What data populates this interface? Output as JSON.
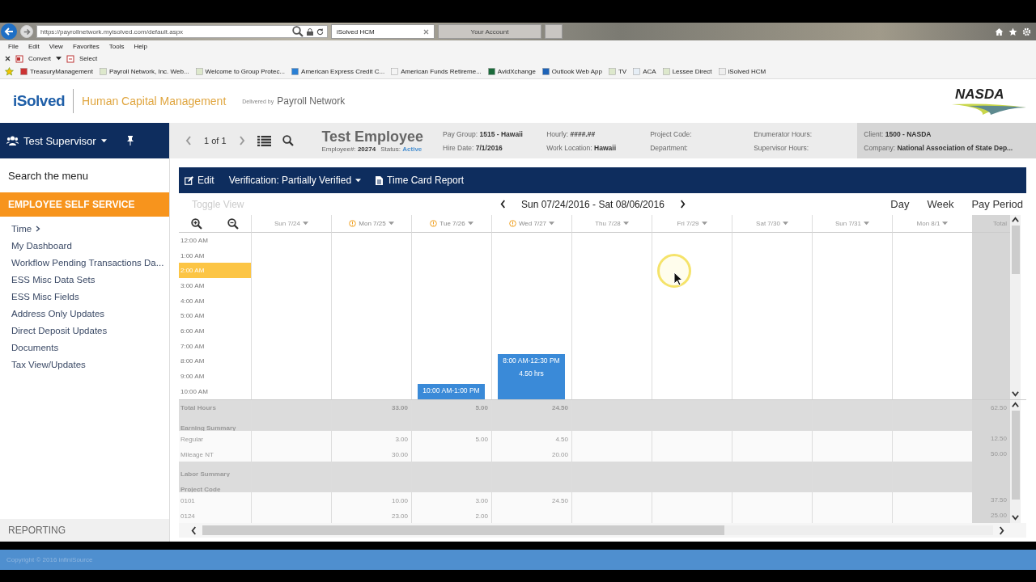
{
  "browser": {
    "address": "https://payrollnetwork.myisolved.com/default.aspx",
    "tabs": [
      {
        "title": "iSolved HCM",
        "selected": true
      },
      {
        "title": "Your Account",
        "selected": false
      }
    ],
    "menu": [
      "File",
      "Edit",
      "View",
      "Favorites",
      "Tools",
      "Help"
    ],
    "commands": [
      "Convert",
      "Select"
    ],
    "favorites": [
      "TreasuryManagement",
      "Payroll Network, Inc. Web...",
      "Welcome to Group Protec...",
      "American Express Credit C...",
      "American Funds Retireme...",
      "AvidXchange",
      "Outlook Web App",
      "TV",
      "ACA",
      "Lessee Direct",
      "iSolved HCM"
    ]
  },
  "header": {
    "logo": "iSolved",
    "product": "Human Capital Management",
    "delivered_by": "Delivered by",
    "partner": "Payroll Network",
    "client_logo": "NASDA"
  },
  "user": {
    "name": "Test Supervisor"
  },
  "pager": "1 of 1",
  "employee": {
    "name": "Test Employee",
    "number_label": "Employee#:",
    "number": "20274",
    "status_label": "Status:",
    "status": "Active",
    "fields": [
      [
        {
          "label": "Pay Group:",
          "value": "1515 - Hawaii"
        },
        {
          "label": "Hire Date:",
          "value": "7/1/2016"
        }
      ],
      [
        {
          "label": "Hourly:",
          "value": "####.##"
        },
        {
          "label": "Work Location:",
          "value": "Hawaii"
        }
      ],
      [
        {
          "label": "Project Code:"
        },
        {
          "label": "Department:"
        }
      ],
      [
        {
          "label": "Enumerator Hours:"
        },
        {
          "label": "Supervisor Hours:"
        }
      ]
    ],
    "client": [
      {
        "label": "Client:",
        "value": "1500 - NASDA"
      },
      {
        "label": "Company:",
        "value": "National Association of State Dep..."
      }
    ]
  },
  "sidebar": {
    "search": {
      "placeholder": "Search the menu"
    },
    "section": "EMPLOYEE SELF SERVICE",
    "items": [
      {
        "label": "Time",
        "submenu": true
      },
      {
        "label": "My Dashboard",
        "submenu": false
      },
      {
        "label": "Workflow Pending Transactions Da...",
        "submenu": false
      },
      {
        "label": "ESS Misc Data Sets",
        "submenu": false
      },
      {
        "label": "ESS Misc Fields",
        "submenu": false
      },
      {
        "label": "Address Only Updates",
        "submenu": false
      },
      {
        "label": "Direct Deposit Updates",
        "submenu": false
      },
      {
        "label": "Documents",
        "submenu": false
      },
      {
        "label": "Tax View/Updates",
        "submenu": false
      }
    ],
    "footer": "REPORTING"
  },
  "toolbar": {
    "edit": "Edit",
    "verification": "Verification: Partially Verified",
    "report": "Time Card Report"
  },
  "calendar": {
    "toggle": {
      "label": "Toggle View",
      "disabled": true
    },
    "range": "Sun 07/24/2016 - Sat 08/06/2016",
    "views": [
      "Day",
      "Week",
      "Pay Period"
    ],
    "total_label": "Total",
    "days": [
      {
        "label": "Sun 7/24",
        "flagged": false
      },
      {
        "label": "Mon 7/25",
        "flagged": true
      },
      {
        "label": "Tue 7/26",
        "flagged": true
      },
      {
        "label": "Wed 7/27",
        "flagged": true
      },
      {
        "label": "Thu 7/28",
        "flagged": false
      },
      {
        "label": "Fri 7/29",
        "flagged": false
      },
      {
        "label": "Sat 7/30",
        "flagged": false
      },
      {
        "label": "Sun 7/31",
        "flagged": false
      },
      {
        "label": "Mon 8/1",
        "flagged": false
      }
    ],
    "hours": [
      {
        "label": "12:00 AM",
        "selected": false
      },
      {
        "label": "1:00 AM",
        "selected": false
      },
      {
        "label": "2:00 AM",
        "selected": true
      },
      {
        "label": "3:00 AM",
        "selected": false
      },
      {
        "label": "4:00 AM",
        "selected": false
      },
      {
        "label": "5:00 AM",
        "selected": false
      },
      {
        "label": "6:00 AM",
        "selected": false
      },
      {
        "label": "7:00 AM",
        "selected": false
      },
      {
        "label": "8:00 AM",
        "selected": false,
        "cells": [
          {
            "kind": "blank"
          },
          {
            "kind": "blank"
          },
          {
            "kind": "blank"
          },
          {
            "kind": "event",
            "time": "8:00 AM-12:30 PM",
            "duration": "4.50 hrs"
          },
          {
            "kind": "blank"
          },
          {
            "kind": "blank"
          },
          {
            "kind": "blank"
          },
          {
            "kind": "blank"
          },
          {
            "kind": "blank"
          }
        ]
      },
      {
        "label": "9:00 AM",
        "selected": false
      },
      {
        "label": "10:00 AM",
        "selected": false,
        "cells": [
          {
            "kind": "blank"
          },
          {
            "kind": "blank"
          },
          {
            "kind": "event",
            "time": "10:00 AM-1:00 PM"
          },
          {
            "kind": "blank"
          },
          {
            "kind": "blank"
          },
          {
            "kind": "blank"
          },
          {
            "kind": "blank"
          },
          {
            "kind": "blank"
          },
          {
            "kind": "blank"
          }
        ]
      }
    ],
    "summary": [
      {
        "kind": "total",
        "label": "Total Hours",
        "cells": [
          {
            "kind": "blank"
          },
          {
            "kind": "value",
            "text": "33.00"
          },
          {
            "kind": "value",
            "text": "5.00"
          },
          {
            "kind": "value",
            "text": "24.50"
          },
          {
            "kind": "blank"
          },
          {
            "kind": "blank"
          },
          {
            "kind": "blank"
          },
          {
            "kind": "blank"
          },
          {
            "kind": "blank"
          }
        ],
        "total": "62.50"
      },
      {
        "kind": "section",
        "label": "Earning Summary"
      },
      {
        "kind": "item",
        "label": "Regular",
        "cells": [
          {
            "kind": "blank"
          },
          {
            "kind": "value",
            "text": "3.00"
          },
          {
            "kind": "value",
            "text": "5.00"
          },
          {
            "kind": "value",
            "text": "4.50"
          },
          {
            "kind": "blank"
          },
          {
            "kind": "blank"
          },
          {
            "kind": "blank"
          },
          {
            "kind": "blank"
          },
          {
            "kind": "blank"
          }
        ],
        "total": "12.50"
      },
      {
        "kind": "item",
        "label": "Mileage NT",
        "cells": [
          {
            "kind": "blank"
          },
          {
            "kind": "value",
            "text": "30.00"
          },
          {
            "kind": "blank"
          },
          {
            "kind": "value",
            "text": "20.00"
          },
          {
            "kind": "blank"
          },
          {
            "kind": "blank"
          },
          {
            "kind": "blank"
          },
          {
            "kind": "blank"
          },
          {
            "kind": "blank"
          }
        ],
        "total": "50.00"
      },
      {
        "kind": "section",
        "label": "Labor Summary"
      },
      {
        "kind": "section",
        "label": "Project Code"
      },
      {
        "kind": "item",
        "label": "0101",
        "cells": [
          {
            "kind": "blank"
          },
          {
            "kind": "value",
            "text": "10.00"
          },
          {
            "kind": "value",
            "text": "3.00"
          },
          {
            "kind": "value",
            "text": "24.50"
          },
          {
            "kind": "blank"
          },
          {
            "kind": "blank"
          },
          {
            "kind": "blank"
          },
          {
            "kind": "blank"
          },
          {
            "kind": "blank"
          }
        ],
        "total": "37.50"
      },
      {
        "kind": "item",
        "label": "0124",
        "cells": [
          {
            "kind": "blank"
          },
          {
            "kind": "value",
            "text": "23.00"
          },
          {
            "kind": "value",
            "text": "2.00"
          },
          {
            "kind": "blank"
          },
          {
            "kind": "blank"
          },
          {
            "kind": "blank"
          },
          {
            "kind": "blank"
          },
          {
            "kind": "blank"
          },
          {
            "kind": "blank"
          }
        ],
        "total": "25.00"
      }
    ]
  },
  "footer": "Copyright © 2016 infiniSource"
}
